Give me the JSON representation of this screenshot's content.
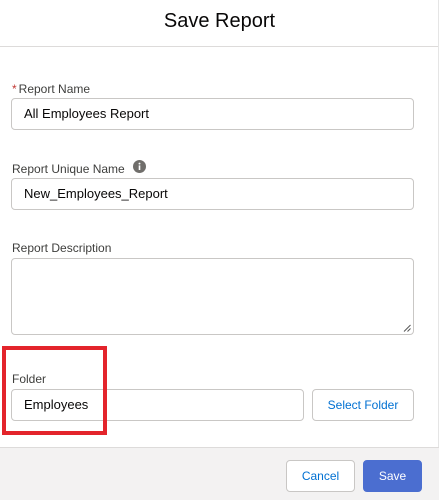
{
  "modal": {
    "title": "Save Report"
  },
  "form": {
    "report_name": {
      "required_marker": "*",
      "label": "Report Name",
      "value": "All Employees Report"
    },
    "report_unique_name": {
      "label": "Report Unique Name",
      "value": "New_Employees_Report",
      "info_icon": "info-icon"
    },
    "report_description": {
      "label": "Report Description",
      "value": ""
    },
    "folder": {
      "label": "Folder",
      "value": "Employees",
      "select_button": "Select Folder"
    }
  },
  "footer": {
    "cancel_label": "Cancel",
    "save_label": "Save"
  },
  "colors": {
    "highlight": "#e3242b",
    "primary_button": "#4b6ed0",
    "link_text": "#0070d2",
    "required": "#c23934"
  }
}
